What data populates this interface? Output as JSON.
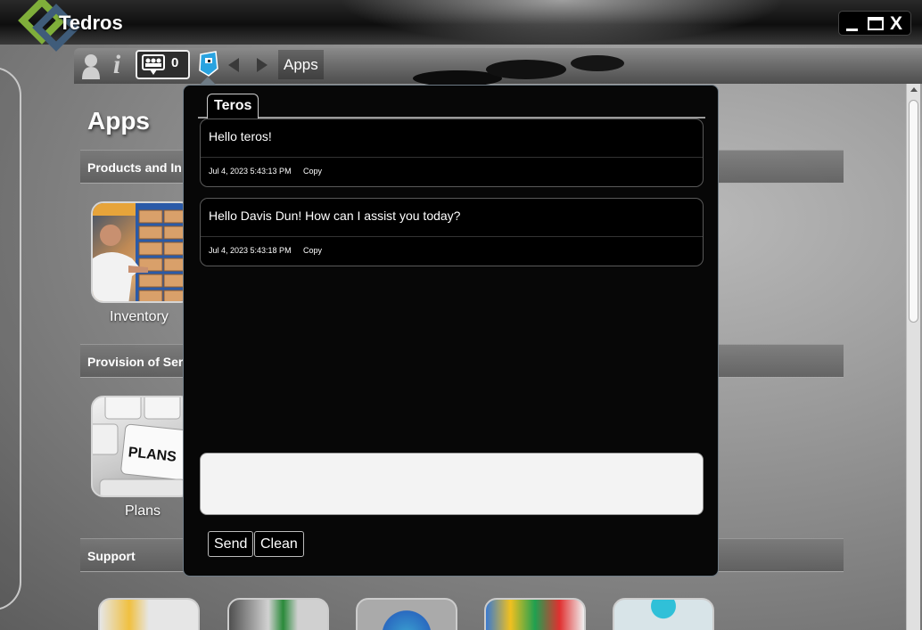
{
  "window": {
    "title": "Tedros",
    "close_label": "X"
  },
  "toolbar": {
    "chat_count": "0",
    "breadcrumb": "Apps"
  },
  "page": {
    "heading": "Apps",
    "sections": [
      {
        "label": "Products and In"
      },
      {
        "label": "Provision of Ser"
      },
      {
        "label": "Support"
      }
    ],
    "tiles": [
      {
        "label": "Inventory"
      },
      {
        "label": "Plans"
      }
    ]
  },
  "chat": {
    "tab_label": "Teros",
    "messages": [
      {
        "text": "Hello teros!",
        "timestamp": "Jul 4, 2023 5:43:13 PM",
        "copy_label": "Copy"
      },
      {
        "text": "Hello Davis Dun! How can I assist you today?",
        "timestamp": "Jul 4, 2023 5:43:18 PM",
        "copy_label": "Copy"
      }
    ],
    "input_value": "",
    "send_label": "Send",
    "clean_label": "Clean"
  },
  "colors": {
    "logo_green": "#7fae3a",
    "logo_blue": "#3f5c7a",
    "teros_icon": "#29a3e0",
    "popup_bg": "#070707",
    "input_bg": "#f3f3f3"
  }
}
